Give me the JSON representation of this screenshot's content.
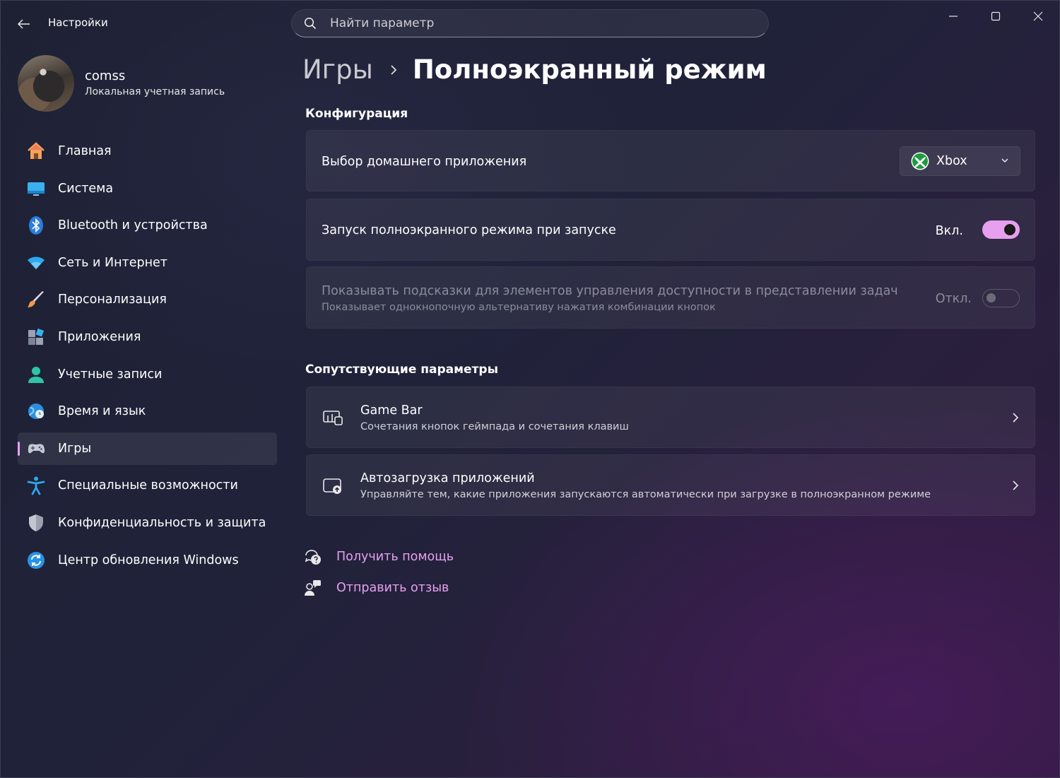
{
  "app": {
    "title": "Настройки"
  },
  "search": {
    "placeholder": "Найти параметр"
  },
  "user": {
    "name": "comss",
    "account_type": "Локальная учетная запись"
  },
  "sidebar": {
    "items": [
      {
        "label": "Главная",
        "icon": "home-icon"
      },
      {
        "label": "Система",
        "icon": "system-icon"
      },
      {
        "label": "Bluetooth и устройства",
        "icon": "bluetooth-icon"
      },
      {
        "label": "Сеть и Интернет",
        "icon": "wifi-icon"
      },
      {
        "label": "Персонализация",
        "icon": "brush-icon"
      },
      {
        "label": "Приложения",
        "icon": "apps-icon"
      },
      {
        "label": "Учетные записи",
        "icon": "account-icon"
      },
      {
        "label": "Время и язык",
        "icon": "globe-clock-icon"
      },
      {
        "label": "Игры",
        "icon": "gamepad-icon",
        "active": true
      },
      {
        "label": "Специальные возможности",
        "icon": "accessibility-icon"
      },
      {
        "label": "Конфиденциальность и защита",
        "icon": "shield-icon"
      },
      {
        "label": "Центр обновления Windows",
        "icon": "update-icon"
      }
    ]
  },
  "breadcrumb": {
    "parent": "Игры",
    "current": "Полноэкранный режим"
  },
  "config": {
    "section_title": "Конфигурация",
    "home_app": {
      "label": "Выбор домашнего приложения",
      "value": "Xbox",
      "icon": "xbox-icon"
    },
    "fullscreen_on_start": {
      "label": "Запуск полноэкранного режима при запуске",
      "state_label": "Вкл.",
      "on": true
    },
    "hints": {
      "label": "Показывать подсказки для элементов управления доступности в представлении задач",
      "description": "Показывает однокнопочную альтернативу нажатия комбинации кнопок",
      "state_label": "Откл.",
      "on": false,
      "disabled": true
    }
  },
  "related": {
    "section_title": "Сопутствующие параметры",
    "items": [
      {
        "title": "Game Bar",
        "subtitle": "Сочетания кнопок геймпада и сочетания клавиш",
        "icon": "game-bar-icon"
      },
      {
        "title": "Автозагрузка приложений",
        "subtitle": "Управляйте тем, какие приложения запускаются автоматически при загрузке в полноэкранном режиме",
        "icon": "startup-apps-icon"
      }
    ]
  },
  "help": {
    "get_help": "Получить помощь",
    "feedback": "Отправить отзыв"
  },
  "colors": {
    "accent": "#e6a0ef",
    "background": "#202236"
  }
}
